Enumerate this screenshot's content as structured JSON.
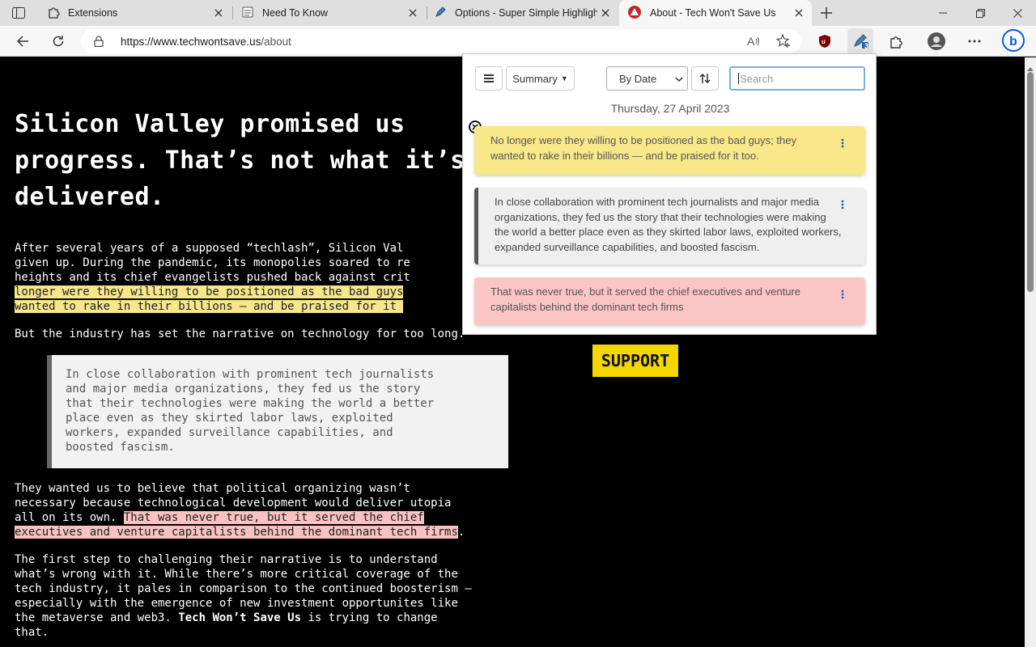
{
  "browser": {
    "tabs": [
      {
        "title": "Extensions",
        "active": false
      },
      {
        "title": "Need To Know",
        "active": false
      },
      {
        "title": "Options - Super Simple Highlight",
        "active": false
      },
      {
        "title": "About - Tech Won't Save Us",
        "active": true
      }
    ],
    "url_host": "https://www.techwontsave.us",
    "url_path": "/about",
    "extension_badge": "3",
    "colors": {
      "tabstrip": "#dfdfdf",
      "toolbar": "#f7f7f7",
      "ublock": "#800000",
      "bing": "#0a5ad6"
    }
  },
  "page": {
    "headline": "Silicon Valley promised us progress. That’s not what it’s delivered.",
    "para1": {
      "line1": "After several years of a supposed “techlash”, Silicon Val",
      "line2": "given up. During the pandemic, its monopolies soared to re",
      "line3": "heights and its chief evangelists pushed back against crit",
      "hl_line4": "longer were they willing to be positioned as the bad guys",
      "hl_line5": "wanted to rake in their billions — and be praised for it "
    },
    "para2": "But the industry has set the narrative on technology for too long.",
    "quote_lines": [
      "In close collaboration with prominent tech journalists",
      "and major media organizations, they fed us the story",
      "that their technologies were making the world a better",
      "place even as they skirted labor laws, exploited",
      "workers, expanded surveillance capabilities, and",
      "boosted fascism."
    ],
    "para3": {
      "line1": "They wanted us to believe that political organizing wasn’t",
      "line2": "necessary because technological development would deliver utopia",
      "line3_plain": "all on its own. ",
      "line3_hl": "That was never true, but it served the chief",
      "line4_hl": "executives and venture capitalists behind the dominant tech firms",
      "line4_end": "."
    },
    "para4": {
      "line1": "The first step to challenging their narrative is to understand",
      "line2": "what’s wrong with it. While there’s more critical coverage of the",
      "line3": "tech industry, it pales in comparison to the continued boosterism —",
      "line4": "especially with the emergence of new investment opportunites like",
      "line5_plain": "the metaverse and web3. ",
      "line5_bold": "Tech Won’t Save Us",
      "line5_end": " is trying to change",
      "line6": "that."
    },
    "support_label": "SUPPORT",
    "colors": {
      "support": "#f4d600",
      "highlight_yellow": "#f8e68c",
      "highlight_red": "#f9c2c2"
    }
  },
  "popup": {
    "summary_label": "Summary",
    "sort_label": "By Date",
    "search_placeholder": "Search",
    "date_heading": "Thursday, 27 April 2023",
    "cards": [
      {
        "text": "No longer were they willing to be positioned as the bad guys; they\nwanted to rake in their billions — and be praised for it too.",
        "style": "yellow"
      },
      {
        "text": "In close collaboration with prominent tech journalists and major media\norganizations, they fed us the story that their technologies were making\nthe world a better place even as they skirted labor laws, exploited workers,\nexpanded surveillance capabilities, and boosted fascism.",
        "style": "quote"
      },
      {
        "text": "That was never true, but it served the chief executives and venture\ncapitalists behind the dominant tech firms",
        "style": "red"
      }
    ]
  }
}
